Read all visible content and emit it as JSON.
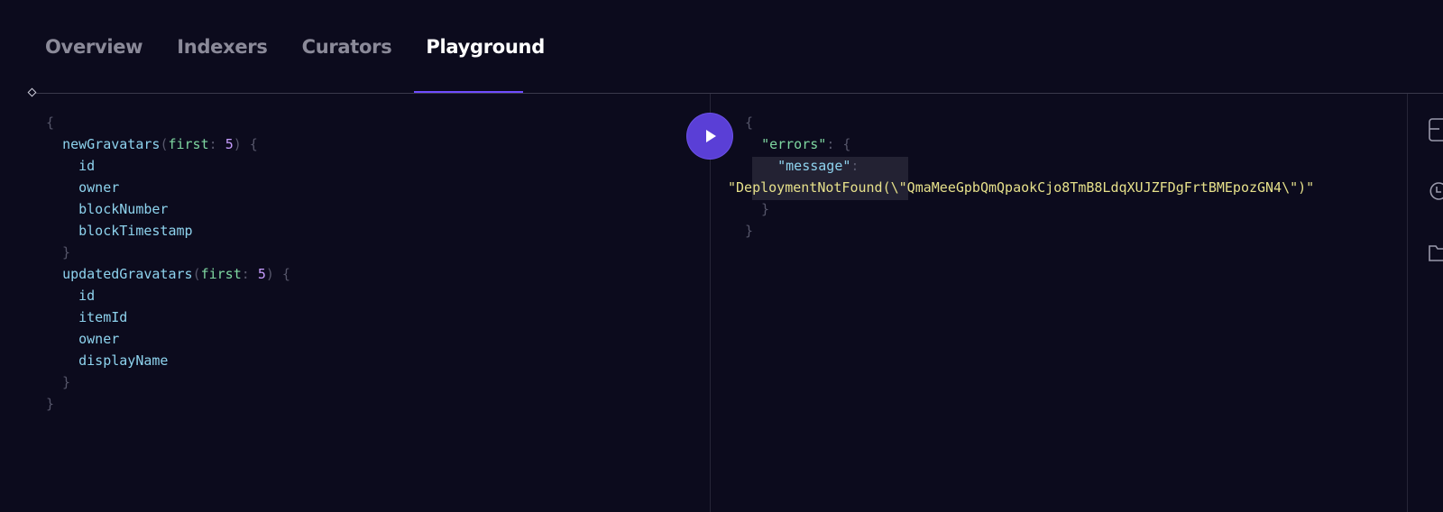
{
  "tabs": [
    {
      "label": "Overview",
      "active": false
    },
    {
      "label": "Indexers",
      "active": false
    },
    {
      "label": "Curators",
      "active": false
    },
    {
      "label": "Playground",
      "active": true
    }
  ],
  "query_editor": {
    "lines": [
      [
        {
          "t": "{",
          "c": "br"
        }
      ],
      [
        {
          "t": "  ",
          "c": ""
        },
        {
          "t": "newGravatars",
          "c": "fld"
        },
        {
          "t": "(",
          "c": "br"
        },
        {
          "t": "first",
          "c": "arg"
        },
        {
          "t": ": ",
          "c": "br"
        },
        {
          "t": "5",
          "c": "num"
        },
        {
          "t": ") {",
          "c": "br"
        }
      ],
      [
        {
          "t": "    ",
          "c": ""
        },
        {
          "t": "id",
          "c": "fld"
        }
      ],
      [
        {
          "t": "    ",
          "c": ""
        },
        {
          "t": "owner",
          "c": "fld"
        }
      ],
      [
        {
          "t": "    ",
          "c": ""
        },
        {
          "t": "blockNumber",
          "c": "fld"
        }
      ],
      [
        {
          "t": "    ",
          "c": ""
        },
        {
          "t": "blockTimestamp",
          "c": "fld"
        }
      ],
      [
        {
          "t": "  }",
          "c": "br"
        }
      ],
      [
        {
          "t": "  ",
          "c": ""
        },
        {
          "t": "updatedGravatars",
          "c": "fld"
        },
        {
          "t": "(",
          "c": "br"
        },
        {
          "t": "first",
          "c": "arg"
        },
        {
          "t": ": ",
          "c": "br"
        },
        {
          "t": "5",
          "c": "num"
        },
        {
          "t": ") {",
          "c": "br"
        }
      ],
      [
        {
          "t": "    ",
          "c": ""
        },
        {
          "t": "id",
          "c": "fld"
        }
      ],
      [
        {
          "t": "    ",
          "c": ""
        },
        {
          "t": "itemId",
          "c": "fld"
        }
      ],
      [
        {
          "t": "    ",
          "c": ""
        },
        {
          "t": "owner",
          "c": "fld"
        }
      ],
      [
        {
          "t": "    ",
          "c": ""
        },
        {
          "t": "displayName",
          "c": "fld"
        }
      ],
      [
        {
          "t": "  }",
          "c": "br"
        }
      ],
      [
        {
          "t": "}",
          "c": "br"
        }
      ]
    ]
  },
  "result_panel": {
    "lines": [
      [
        {
          "t": "{",
          "c": "br"
        }
      ],
      [
        {
          "t": "  ",
          "c": ""
        },
        {
          "t": "\"errors\"",
          "c": "key"
        },
        {
          "t": ": {",
          "c": "br"
        }
      ],
      [
        {
          "t": "    ",
          "c": ""
        },
        {
          "t": "\"message\"",
          "c": "fld"
        },
        {
          "t": ":",
          "c": "br"
        }
      ],
      [
        {
          "t": "\"DeploymentNotFound(\\\"QmaMeeGpbQmQpaokCjo8TmB8LdqXUJZFDgFrtBMEpozGN4\\\")\"",
          "c": "str",
          "outdent": true
        }
      ],
      [
        {
          "t": "  }",
          "c": "br"
        }
      ],
      [
        {
          "t": "}",
          "c": "br"
        }
      ]
    ]
  },
  "run_button": {
    "icon": "play-icon"
  },
  "sidebar_icons": [
    "document-icon",
    "history-icon",
    "folder-icon"
  ]
}
